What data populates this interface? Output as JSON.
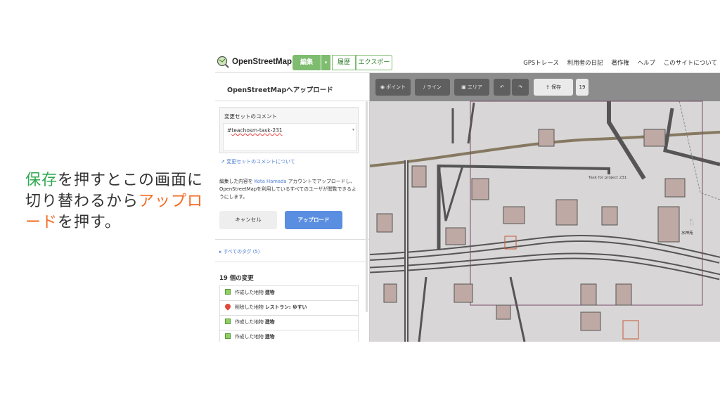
{
  "slide": {
    "caption_green": "保存",
    "caption_mid": "を押すとこの画面に切り替わるから",
    "caption_orange": "アップロード",
    "caption_end": "を押す。"
  },
  "navbar": {
    "brand": "OpenStreetMap",
    "edit_label": "編集",
    "edit_caret": "▾",
    "history_label": "履歴",
    "export_label": "エクスポート",
    "links": [
      "GPSトレース",
      "利用者の日記",
      "著作権",
      "ヘルプ",
      "このサイトについて"
    ]
  },
  "sidebar": {
    "title": "OpenStreetMapへアップロード",
    "comment_label": "変更セットのコメント",
    "comment_prefix": "#",
    "comment_value": "teachosm-task-231",
    "comment_caret": "▾",
    "about_link": "変更セットのコメントについて",
    "info_prefix": "編集した内容を",
    "info_user": "Kota Hamada",
    "info_suffix": "アカウントでアップロードし、OpenStreetMapを利用しているすべてのユーザが閲覧できるようにします。",
    "cancel_label": "キャンセル",
    "upload_label": "アップロード",
    "tags_link": "▸ すべてのタグ (5)",
    "changes_title": "19 個の変更",
    "changes": [
      {
        "icon": "area-icon",
        "text": "作成した地物",
        "target": "建物"
      },
      {
        "icon": "pin-icon",
        "text": "削除した地物",
        "target": "レストラン: ゆすい"
      },
      {
        "icon": "area-icon",
        "text": "作成した地物",
        "target": "建物"
      },
      {
        "icon": "area-icon",
        "text": "作成した地物",
        "target": "建物"
      }
    ]
  },
  "map": {
    "toolbar": {
      "point_label": "ポイント",
      "line_label": "ライン",
      "area_label": "エリア",
      "save_label": "保存",
      "count": "19"
    },
    "task_label": "Task for project 231",
    "place_label": "水神苑",
    "colors": {
      "background": "#d8d6d6",
      "road": "#555555",
      "building": "#bfa9a4",
      "path": "#6b5a3a",
      "task_boundary": "#7a4a6a"
    }
  }
}
